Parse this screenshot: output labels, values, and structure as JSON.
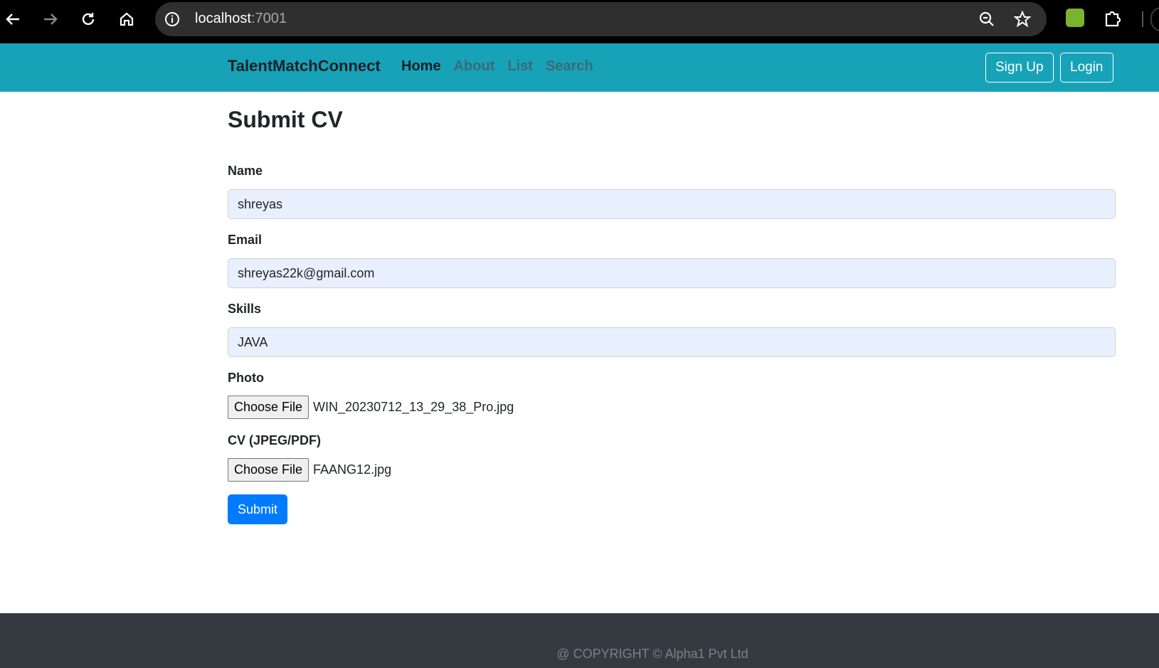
{
  "browser": {
    "url_host": "localhost",
    "url_port": ":7001",
    "icons": [
      "back-arrow-icon",
      "forward-arrow-icon",
      "reload-icon",
      "home-icon",
      "info-icon",
      "zoom-icon",
      "bookmark-star-icon",
      "extension-icon",
      "puzzle-icon"
    ]
  },
  "navbar": {
    "brand": "TalentMatchConnect",
    "links": [
      {
        "label": "Home",
        "active": true
      },
      {
        "label": "About",
        "active": false
      },
      {
        "label": "List",
        "active": false
      },
      {
        "label": "Search",
        "active": false
      }
    ],
    "signup_label": "Sign Up",
    "login_label": "Login",
    "bg_color": "#17a2b8"
  },
  "form": {
    "title": "Submit CV",
    "name_label": "Name",
    "name_value": "shreyas",
    "email_label": "Email",
    "email_value": "shreyas22k@gmail.com",
    "skills_label": "Skills",
    "skills_value": "JAVA",
    "photo_label": "Photo",
    "photo_button": "Choose File",
    "photo_file": "WIN_20230712_13_29_38_Pro.jpg",
    "cv_label": "CV (JPEG/PDF)",
    "cv_button": "Choose File",
    "cv_file": "FAANG12.jpg",
    "submit_label": "Submit",
    "submit_color": "#007bff"
  },
  "footer": {
    "text": "@ COPYRIGHT © Alpha1 Pvt Ltd"
  }
}
